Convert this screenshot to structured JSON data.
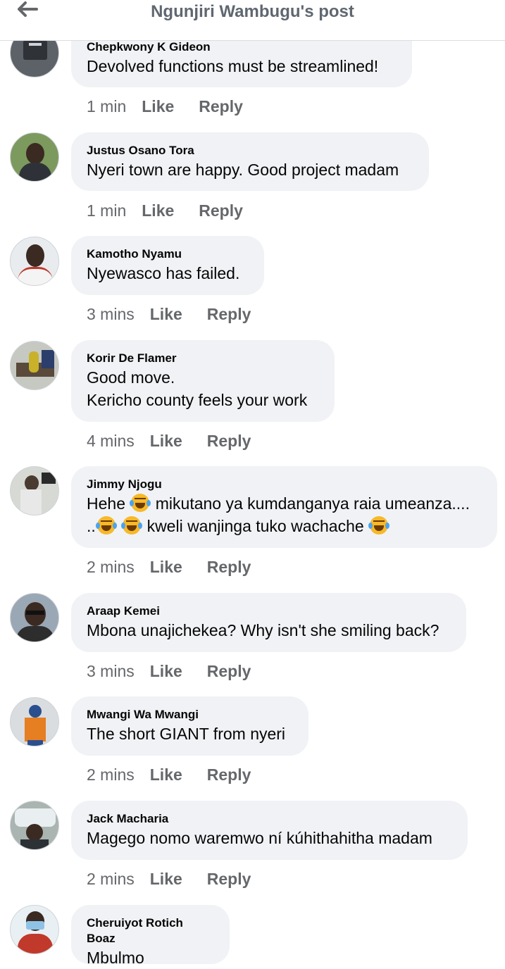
{
  "header": {
    "title": "Ngunjiri Wambugu's post"
  },
  "actions": {
    "like": "Like",
    "reply": "Reply"
  },
  "comments": [
    {
      "name": "Chepkwony K Gideon",
      "lines": [
        "Devolved functions must be streamlined!"
      ],
      "time": "1 min"
    },
    {
      "name": "Justus Osano Tora",
      "lines": [
        "Nyeri town are happy. Good project madam"
      ],
      "time": "1 min"
    },
    {
      "name": "Kamotho Nyamu",
      "lines": [
        "Nyewasco has failed."
      ],
      "time": "3 mins"
    },
    {
      "name": "Korir De Flamer",
      "lines": [
        "Good move.",
        "Kericho county feels your work"
      ],
      "time": "4 mins"
    },
    {
      "name": "Jimmy Njogu",
      "line1_a": "Hehe",
      "line1_b": "mikutano ya kumdanganya raia umeanza....",
      "line2_a": "..",
      "line2_b": "kweli wanjinga tuko wachache",
      "time": "2 mins",
      "emoji": "laughing-tears-emoji"
    },
    {
      "name": "Araap Kemei",
      "lines": [
        "Mbona unajichekea? Why isn't she smiling back?"
      ],
      "time": "3 mins"
    },
    {
      "name": "Mwangi Wa Mwangi",
      "lines": [
        "The short GIANT from nyeri"
      ],
      "time": "2 mins"
    },
    {
      "name": "Jack Macharia",
      "lines": [
        "Magego nomo waremwo ní kúhithahitha madam"
      ],
      "time": "2 mins"
    },
    {
      "name": "Cheruiyot Rotich Boaz",
      "lines": [
        "Mbulmo"
      ]
    }
  ]
}
